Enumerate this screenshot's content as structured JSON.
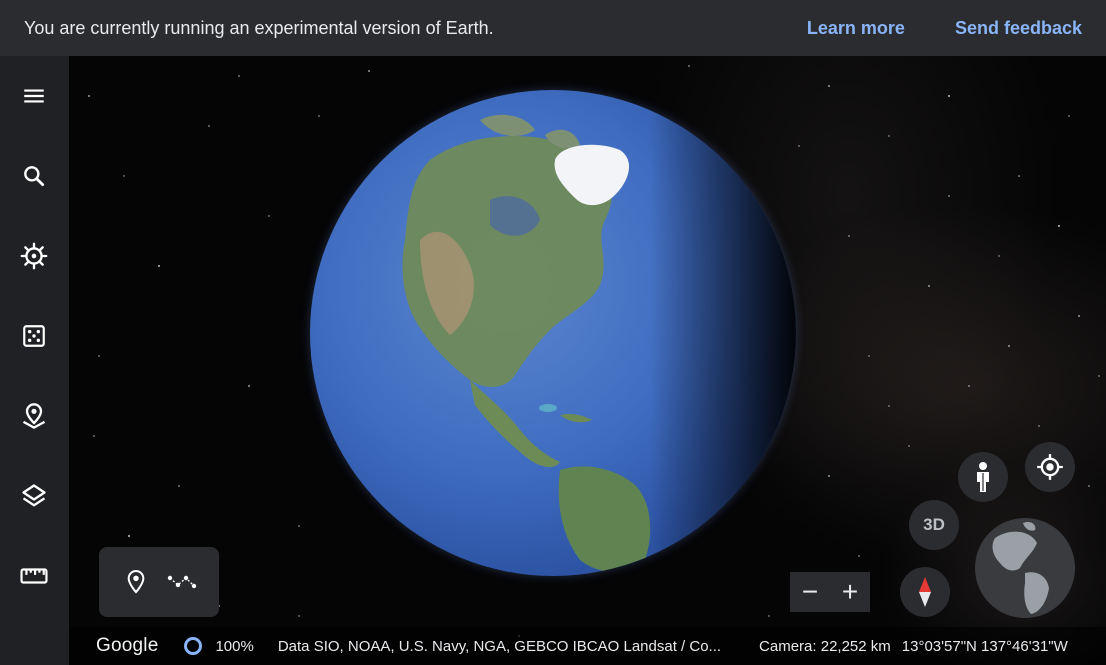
{
  "banner": {
    "message": "You are currently running an experimental version of Earth.",
    "learn_more": "Learn more",
    "send_feedback": "Send feedback"
  },
  "sidebar": {
    "items": [
      {
        "icon": "menu-icon"
      },
      {
        "icon": "search-icon"
      },
      {
        "icon": "voyager-icon"
      },
      {
        "icon": "feeling-lucky-icon"
      },
      {
        "icon": "projects-icon"
      },
      {
        "icon": "map-style-icon"
      },
      {
        "icon": "measure-icon"
      }
    ]
  },
  "map_controls": {
    "btn_3d": "3D",
    "zoom_out": "−",
    "zoom_in": "+"
  },
  "footer": {
    "logo": "Google",
    "load_percent": "100%",
    "attribution": "Data SIO, NOAA, U.S. Navy, NGA, GEBCO  IBCAO  Landsat / Co...",
    "camera": "Camera: 22,252 km",
    "coordinates": "13°03'57\"N 137°46'31\"W"
  },
  "colors": {
    "accent": "#8ab4f8",
    "banner_bg": "#2a2c30",
    "sidebar_bg": "#202124",
    "ocean": "#3f6cc0"
  }
}
